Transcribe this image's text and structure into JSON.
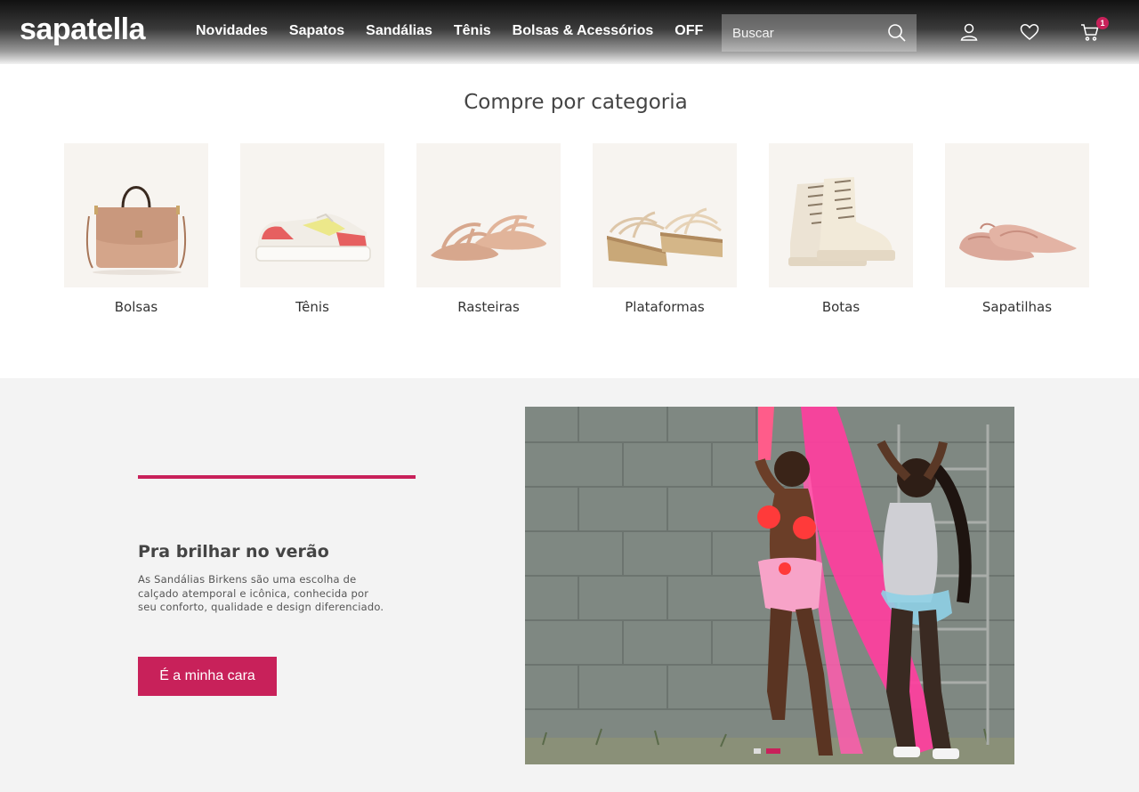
{
  "brand": {
    "logo_text": "sapatella",
    "accent_color": "#c8215a"
  },
  "nav": {
    "items": [
      {
        "label": "Novidades"
      },
      {
        "label": "Sapatos"
      },
      {
        "label": "Sandálias"
      },
      {
        "label": "Tênis"
      },
      {
        "label": "Bolsas & Acessórios"
      },
      {
        "label": "OFF"
      }
    ]
  },
  "search": {
    "placeholder": "Buscar",
    "icon": "search-icon"
  },
  "header_icons": {
    "account": "user-icon",
    "wishlist": "heart-icon",
    "cart": "cart-icon",
    "cart_count": "1"
  },
  "categories": {
    "title": "Compre por categoria",
    "items": [
      {
        "label": "Bolsas",
        "image": "bag"
      },
      {
        "label": "Tênis",
        "image": "sneaker"
      },
      {
        "label": "Rasteiras",
        "image": "flat-sandal"
      },
      {
        "label": "Plataformas",
        "image": "platform-sandal"
      },
      {
        "label": "Botas",
        "image": "boot"
      },
      {
        "label": "Sapatilhas",
        "image": "ballet-flat"
      }
    ]
  },
  "feature": {
    "title": "Pra brilhar no verão",
    "description": "As Sandálias Birkens são uma escolha de calçado atemporal e icônica, conhecida por seu conforto, qualidade e design diferenciado.",
    "button_label": "É a minha cara",
    "carousel": {
      "slide_count": 2,
      "active_slide": 2
    }
  }
}
